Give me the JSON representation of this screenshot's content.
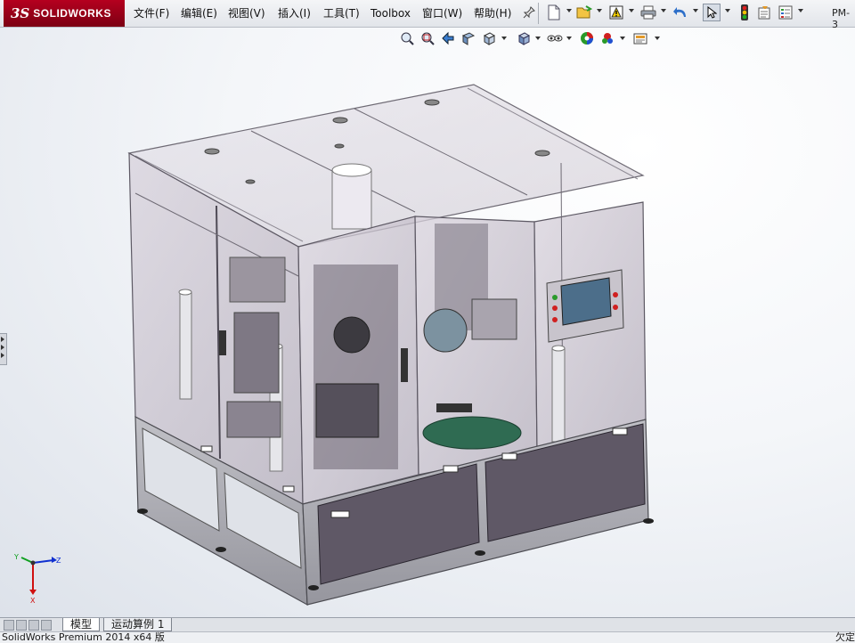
{
  "app": {
    "logo_mark": "3S",
    "logo_text": "SOLIDWORKS",
    "document_tab": "PM-3"
  },
  "menu": [
    {
      "label": "文件(F)"
    },
    {
      "label": "编辑(E)"
    },
    {
      "label": "视图(V)"
    },
    {
      "label": "插入(I)"
    },
    {
      "label": "工具(T)"
    },
    {
      "label": "Toolbox"
    },
    {
      "label": "窗口(W)"
    },
    {
      "label": "帮助(H)"
    }
  ],
  "toolbar": [
    {
      "icon": "pin-icon"
    },
    {
      "icon": "new-document-icon"
    },
    {
      "icon": "open-folder-icon"
    },
    {
      "icon": "rebuild-icon"
    },
    {
      "icon": "print-icon"
    },
    {
      "icon": "undo-icon"
    },
    {
      "icon": "select-pointer-icon"
    },
    {
      "icon": "traffic-light-icon"
    },
    {
      "icon": "file-properties-icon"
    },
    {
      "icon": "options-icon"
    }
  ],
  "view_toolbar": [
    {
      "icon": "zoom-to-fit-icon"
    },
    {
      "icon": "zoom-to-area-icon"
    },
    {
      "icon": "previous-view-icon"
    },
    {
      "icon": "section-view-icon"
    },
    {
      "icon": "view-orientation-icon"
    },
    {
      "icon": "display-style-icon"
    },
    {
      "icon": "hide-show-items-icon"
    },
    {
      "icon": "edit-appearance-icon"
    },
    {
      "icon": "apply-scene-icon"
    },
    {
      "icon": "view-settings-icon"
    }
  ],
  "triad": {
    "x_label": "X",
    "y_label": "Y",
    "z_label": "Z"
  },
  "bottom_tabs": [
    {
      "label": "模型"
    },
    {
      "label": "运动算例 1"
    }
  ],
  "status": {
    "left": "SolidWorks Premium 2014 x64 版",
    "right": "欠定"
  },
  "colors": {
    "logo_red": "#a8001c",
    "glass_fill": "#c9c3cd",
    "base_frame": "#a7a7ad",
    "drawer_panel": "#5f5866",
    "hmi_screen": "#4c6e8a",
    "triad_x": "#d01010",
    "triad_y": "#10a020",
    "triad_z": "#1030d0"
  }
}
